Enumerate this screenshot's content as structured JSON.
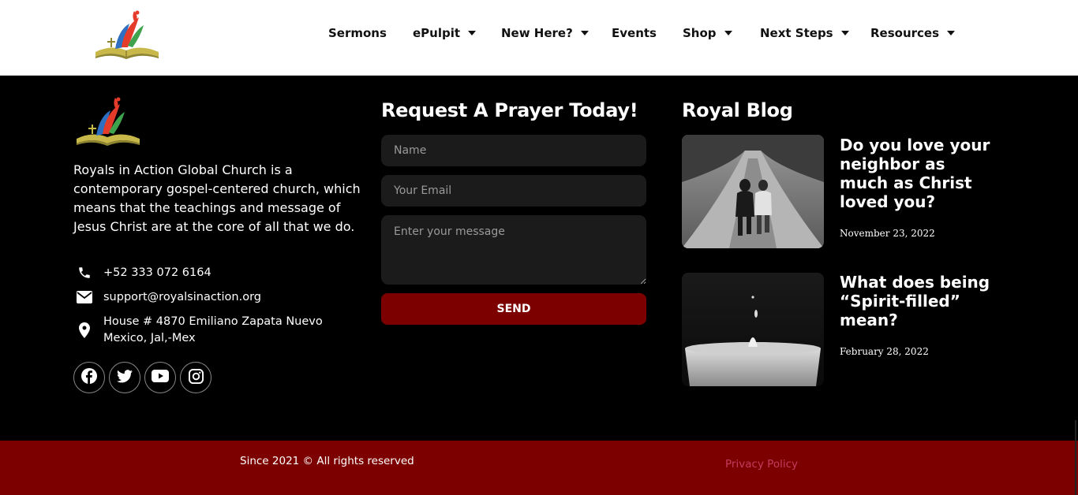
{
  "header": {
    "nav": [
      {
        "label": "Sermons",
        "dropdown": false
      },
      {
        "label": "ePulpit",
        "dropdown": true
      },
      {
        "label": "New Here?",
        "dropdown": true
      },
      {
        "label": "Events",
        "dropdown": false
      },
      {
        "label": "Shop",
        "dropdown": true
      },
      {
        "label": "Next Steps",
        "dropdown": true
      },
      {
        "label": "Resources",
        "dropdown": true
      }
    ]
  },
  "about": {
    "text": "Royals in Action Global Church is a contemporary gospel-centered church, which means that the teachings and message of Jesus Christ are at the core of all that we do."
  },
  "contact": {
    "phone": "+52 333 072 6164",
    "email": "support@royalsinaction.org",
    "address": "House # 4870 Emiliano Zapata Nuevo Mexico, Jal,-Mex"
  },
  "socials": [
    "facebook-icon",
    "twitter-icon",
    "youtube-icon",
    "instagram-icon"
  ],
  "prayer": {
    "title": "Request A Prayer Today!",
    "name_placeholder": "Name",
    "email_placeholder": "Your Email",
    "message_placeholder": "Enter your message",
    "send_label": "SEND"
  },
  "blog": {
    "title": "Royal Blog",
    "posts": [
      {
        "title": "Do you love your neighbor as much as Christ loved you?",
        "date": "November 23, 2022"
      },
      {
        "title": "What does being “Spirit-filled” mean?",
        "date": "February 28, 2022"
      }
    ]
  },
  "bottom": {
    "copyright": "Since 2021 © All rights reserved",
    "privacy": "Privacy Policy"
  },
  "colors": {
    "brand_red": "#7d0000",
    "privacy_link": "#c43b5e",
    "field_bg": "#1b1b1b"
  }
}
